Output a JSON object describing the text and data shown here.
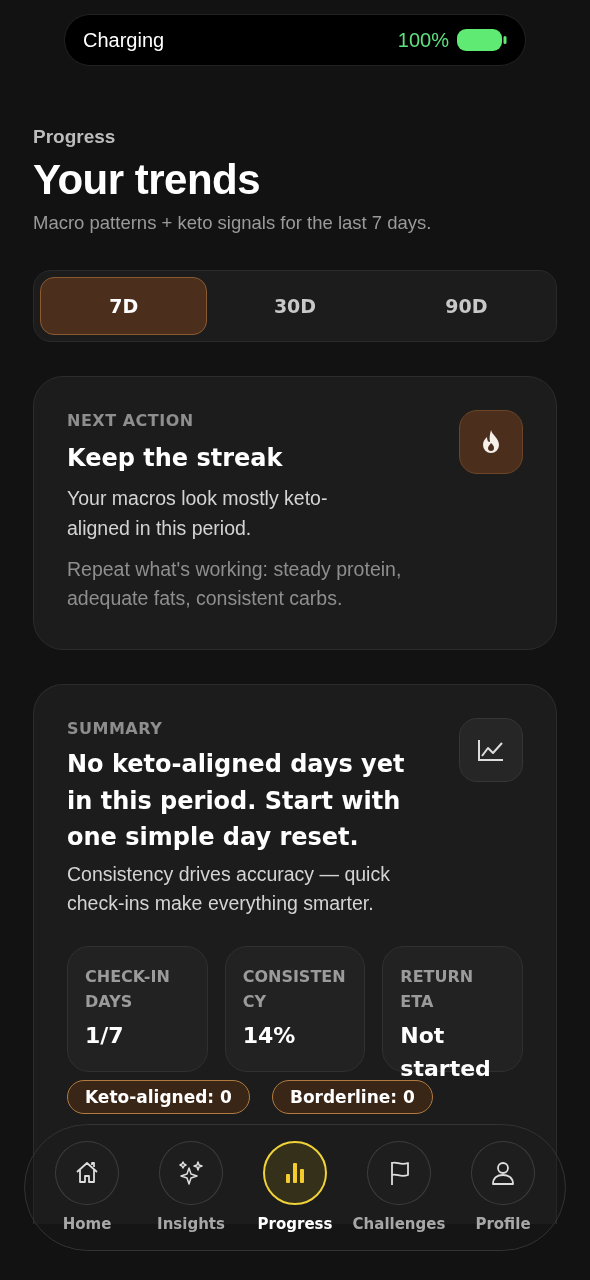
{
  "status": {
    "label": "Charging",
    "battery": "100%"
  },
  "header": {
    "eyebrow": "Progress",
    "title": "Your trends",
    "subtitle": "Macro patterns + keto signals for the last 7 days."
  },
  "ranges": [
    {
      "label": "7D",
      "selected": true
    },
    {
      "label": "30D",
      "selected": false
    },
    {
      "label": "90D",
      "selected": false
    }
  ],
  "cards": [
    {
      "kind": "action",
      "eyebrow": "NEXT ACTION",
      "title": "Keep the streak",
      "body": "Your macros look mostly keto-aligned in this period.",
      "note": "Repeat what's working: steady protein, adequate fats, consistent carbs."
    },
    {
      "kind": "summary",
      "eyebrow": "SUMMARY",
      "title": "No keto-aligned days yet in this period. Start with one simple day reset.",
      "body": "Consistency drives accuracy — quick check-ins make everything smarter.",
      "stats": [
        {
          "label": "CHECK-IN DAYS",
          "value": "1/7"
        },
        {
          "label": "CONSISTENCY",
          "value": "14%"
        },
        {
          "label": "RETURN ETA",
          "value": "Not started"
        }
      ],
      "chips": [
        {
          "label": "Keto-aligned: 0"
        },
        {
          "label": "Borderline: 0"
        }
      ]
    }
  ],
  "nav": [
    {
      "label": "Home",
      "selected": false
    },
    {
      "label": "Insights",
      "selected": false
    },
    {
      "label": "Progress",
      "selected": true
    },
    {
      "label": "Challenges",
      "selected": false
    },
    {
      "label": "Profile",
      "selected": false
    }
  ]
}
